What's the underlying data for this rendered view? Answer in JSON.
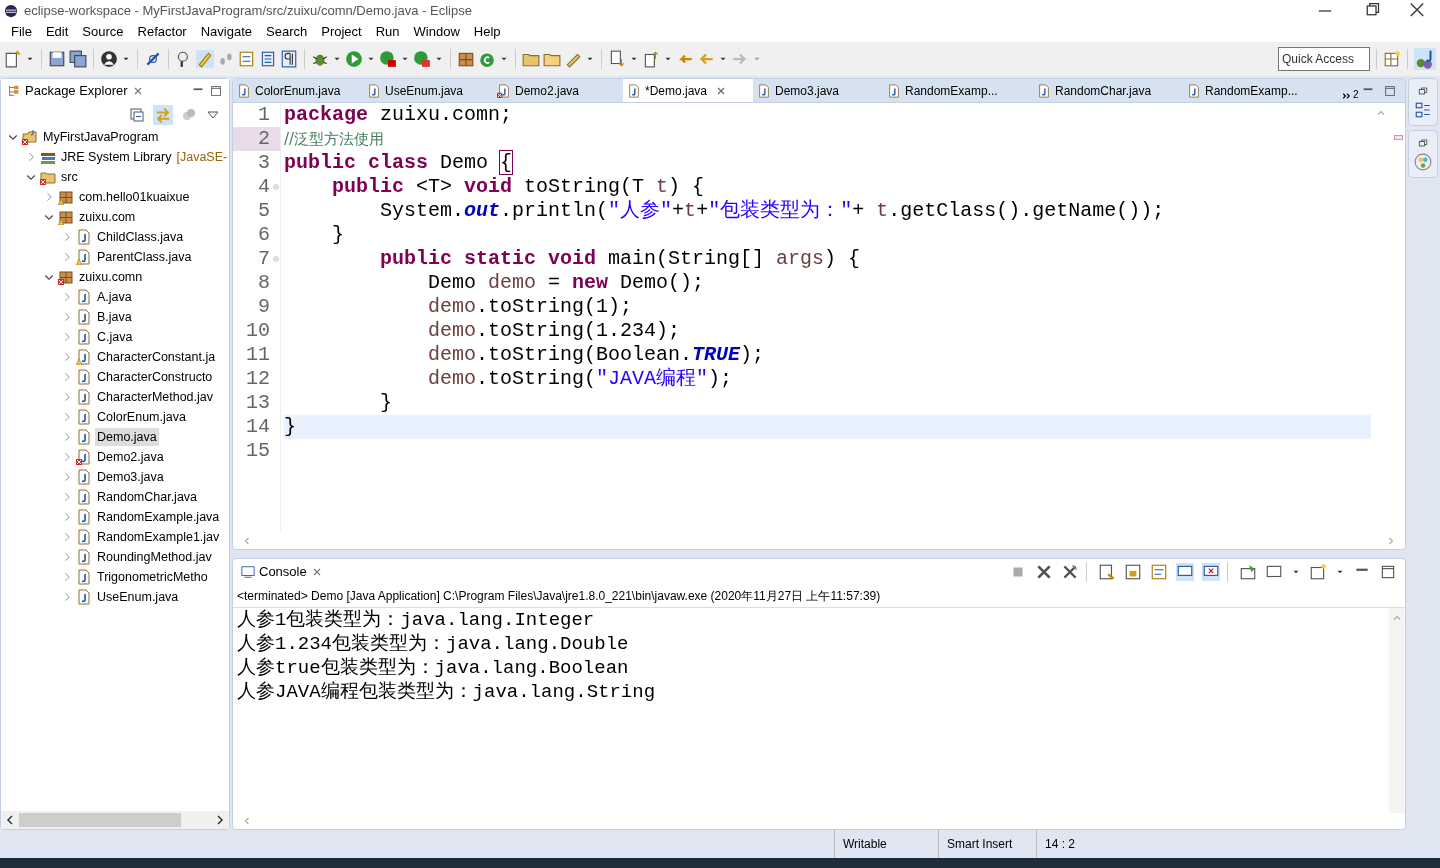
{
  "window": {
    "title": "eclipse-workspace - MyFirstJavaProgram/src/zuixu/comn/Demo.java - Eclipse"
  },
  "menu": [
    "File",
    "Edit",
    "Source",
    "Refactor",
    "Navigate",
    "Search",
    "Project",
    "Run",
    "Window",
    "Help"
  ],
  "quick_access": {
    "placeholder": "Quick Access"
  },
  "package_explorer": {
    "title": "Package Explorer",
    "tree": [
      {
        "label": "MyFirstJavaProgram",
        "kind": "project",
        "error": true,
        "warning": false,
        "expanded": true,
        "selected": false,
        "children": [
          {
            "label": "JRE System Library",
            "suffix": "[JavaSE-",
            "kind": "library",
            "error": false,
            "warning": false,
            "expanded": false,
            "selected": false
          },
          {
            "label": "src",
            "kind": "folder",
            "error": true,
            "warning": false,
            "expanded": true,
            "selected": false,
            "children": [
              {
                "label": "com.hello01kuaixue",
                "kind": "package",
                "error": false,
                "warning": true,
                "expanded": false,
                "selected": false
              },
              {
                "label": "zuixu.com",
                "kind": "package",
                "error": false,
                "warning": true,
                "expanded": true,
                "selected": false,
                "children": [
                  {
                    "label": "ChildClass.java",
                    "kind": "file",
                    "error": false,
                    "warning": false,
                    "expanded": false,
                    "selected": false
                  },
                  {
                    "label": "ParentClass.java",
                    "kind": "file",
                    "error": false,
                    "warning": true,
                    "expanded": false,
                    "selected": false
                  }
                ]
              },
              {
                "label": "zuixu.comn",
                "kind": "package",
                "error": true,
                "warning": false,
                "expanded": true,
                "selected": false,
                "children": [
                  {
                    "label": "A.java",
                    "kind": "file",
                    "error": false,
                    "warning": false,
                    "expanded": false,
                    "selected": false
                  },
                  {
                    "label": "B.java",
                    "kind": "file",
                    "error": false,
                    "warning": false,
                    "expanded": false,
                    "selected": false
                  },
                  {
                    "label": "C.java",
                    "kind": "file",
                    "error": false,
                    "warning": false,
                    "expanded": false,
                    "selected": false
                  },
                  {
                    "label": "CharacterConstant.ja",
                    "kind": "file",
                    "error": false,
                    "warning": true,
                    "expanded": false,
                    "selected": false
                  },
                  {
                    "label": "CharacterConstructo",
                    "kind": "file",
                    "error": false,
                    "warning": false,
                    "expanded": false,
                    "selected": false
                  },
                  {
                    "label": "CharacterMethod.jav",
                    "kind": "file",
                    "error": false,
                    "warning": false,
                    "expanded": false,
                    "selected": false
                  },
                  {
                    "label": "ColorEnum.java",
                    "kind": "file",
                    "error": false,
                    "warning": false,
                    "expanded": false,
                    "selected": false
                  },
                  {
                    "label": "Demo.java",
                    "kind": "file",
                    "error": false,
                    "warning": false,
                    "expanded": false,
                    "selected": true
                  },
                  {
                    "label": "Demo2.java",
                    "kind": "file",
                    "error": true,
                    "warning": false,
                    "expanded": false,
                    "selected": false
                  },
                  {
                    "label": "Demo3.java",
                    "kind": "file",
                    "error": false,
                    "warning": false,
                    "expanded": false,
                    "selected": false
                  },
                  {
                    "label": "RandomChar.java",
                    "kind": "file",
                    "error": false,
                    "warning": false,
                    "expanded": false,
                    "selected": false
                  },
                  {
                    "label": "RandomExample.java",
                    "kind": "file",
                    "error": false,
                    "warning": false,
                    "expanded": false,
                    "selected": false
                  },
                  {
                    "label": "RandomExample1.jav",
                    "kind": "file",
                    "error": false,
                    "warning": false,
                    "expanded": false,
                    "selected": false
                  },
                  {
                    "label": "RoundingMethod.jav",
                    "kind": "file",
                    "error": false,
                    "warning": false,
                    "expanded": false,
                    "selected": false
                  },
                  {
                    "label": "TrigonometricMetho",
                    "kind": "file",
                    "error": false,
                    "warning": false,
                    "expanded": false,
                    "selected": false
                  },
                  {
                    "label": "UseEnum.java",
                    "kind": "file",
                    "error": false,
                    "warning": false,
                    "expanded": false,
                    "selected": false
                  }
                ]
              }
            ]
          }
        ]
      }
    ]
  },
  "editor_tabs": [
    {
      "label": "ColorEnum.java",
      "error": false,
      "selected": false
    },
    {
      "label": "UseEnum.java",
      "error": false,
      "selected": false
    },
    {
      "label": "Demo2.java",
      "error": true,
      "selected": false
    },
    {
      "label": "*Demo.java",
      "error": false,
      "selected": true
    },
    {
      "label": "Demo3.java",
      "error": false,
      "selected": false
    },
    {
      "label": "RandomExamp...",
      "error": false,
      "selected": false
    },
    {
      "label": "RandomChar.java",
      "error": false,
      "selected": false
    },
    {
      "label": "RandomExamp...",
      "error": false,
      "selected": false
    }
  ],
  "hidden_tab_count": "2",
  "code": [
    {
      "no": "1",
      "foldable": false,
      "current": false,
      "marked": false,
      "tokens": [
        {
          "t": "package",
          "kind": "kw"
        },
        {
          "t": " zuixu.comn;",
          "kind": "plain"
        }
      ]
    },
    {
      "no": "2",
      "foldable": false,
      "current": false,
      "marked": true,
      "tokens": [
        {
          "t": "//泛型方法使用",
          "kind": "comment"
        }
      ]
    },
    {
      "no": "3",
      "foldable": false,
      "current": false,
      "marked": false,
      "tokens": [
        {
          "t": "public class",
          "kind": "kw"
        },
        {
          "t": " Demo ",
          "kind": "plain"
        },
        {
          "t": "{",
          "kind": "bracket"
        }
      ]
    },
    {
      "no": "4",
      "foldable": true,
      "current": false,
      "marked": false,
      "tokens": [
        {
          "t": "    public",
          "kind": "kw"
        },
        {
          "t": " <T> ",
          "kind": "plain"
        },
        {
          "t": "void",
          "kind": "kw"
        },
        {
          "t": " toString(T ",
          "kind": "plain"
        },
        {
          "t": "t",
          "kind": "param"
        },
        {
          "t": ") {",
          "kind": "plain"
        }
      ]
    },
    {
      "no": "5",
      "foldable": false,
      "current": false,
      "marked": false,
      "tokens": [
        {
          "t": "        System.",
          "kind": "plain"
        },
        {
          "t": "out",
          "kind": "field"
        },
        {
          "t": ".println(",
          "kind": "plain"
        },
        {
          "t": "\"人参\"",
          "kind": "string"
        },
        {
          "t": "+",
          "kind": "plain"
        },
        {
          "t": "t",
          "kind": "param"
        },
        {
          "t": "+",
          "kind": "plain"
        },
        {
          "t": "\"包装类型为：\"",
          "kind": "string"
        },
        {
          "t": "+ ",
          "kind": "plain"
        },
        {
          "t": "t",
          "kind": "param"
        },
        {
          "t": ".getClass().getName());",
          "kind": "plain"
        }
      ]
    },
    {
      "no": "6",
      "foldable": false,
      "current": false,
      "marked": false,
      "tokens": [
        {
          "t": "    }",
          "kind": "plain"
        }
      ]
    },
    {
      "no": "7",
      "foldable": true,
      "current": false,
      "marked": false,
      "tokens": [
        {
          "t": "        public static void",
          "kind": "kw"
        },
        {
          "t": " main(String[] ",
          "kind": "plain"
        },
        {
          "t": "args",
          "kind": "param"
        },
        {
          "t": ") {",
          "kind": "plain"
        }
      ]
    },
    {
      "no": "8",
      "foldable": false,
      "current": false,
      "marked": false,
      "tokens": [
        {
          "t": "            Demo ",
          "kind": "plain"
        },
        {
          "t": "demo",
          "kind": "local"
        },
        {
          "t": " = ",
          "kind": "plain"
        },
        {
          "t": "new",
          "kind": "kw"
        },
        {
          "t": " Demo();",
          "kind": "plain"
        }
      ]
    },
    {
      "no": "9",
      "foldable": false,
      "current": false,
      "marked": false,
      "tokens": [
        {
          "t": "            demo",
          "kind": "local"
        },
        {
          "t": ".toString(1);",
          "kind": "plain"
        }
      ]
    },
    {
      "no": "10",
      "foldable": false,
      "current": false,
      "marked": false,
      "tokens": [
        {
          "t": "            demo",
          "kind": "local"
        },
        {
          "t": ".toString(1.234);",
          "kind": "plain"
        }
      ]
    },
    {
      "no": "11",
      "foldable": false,
      "current": false,
      "marked": false,
      "tokens": [
        {
          "t": "            demo",
          "kind": "local"
        },
        {
          "t": ".toString(Boolean.",
          "kind": "plain"
        },
        {
          "t": "TRUE",
          "kind": "field"
        },
        {
          "t": ");",
          "kind": "plain"
        }
      ]
    },
    {
      "no": "12",
      "foldable": false,
      "current": false,
      "marked": false,
      "tokens": [
        {
          "t": "            demo",
          "kind": "local"
        },
        {
          "t": ".toString(",
          "kind": "plain"
        },
        {
          "t": "\"JAVA编程\"",
          "kind": "string"
        },
        {
          "t": ");",
          "kind": "plain"
        }
      ]
    },
    {
      "no": "13",
      "foldable": false,
      "current": false,
      "marked": false,
      "tokens": [
        {
          "t": "        }",
          "kind": "plain"
        }
      ]
    },
    {
      "no": "14",
      "foldable": false,
      "current": true,
      "marked": false,
      "tokens": [
        {
          "t": "}",
          "kind": "plain"
        }
      ]
    },
    {
      "no": "15"
    }
  ],
  "console": {
    "title": "Console",
    "status": "<terminated> Demo [Java Application] C:\\Program Files\\Java\\jre1.8.0_221\\bin\\javaw.exe (2020年11月27日 上午11:57:39)",
    "lines": [
      "人参1包装类型为：java.lang.Integer",
      "人参1.234包装类型为：java.lang.Double",
      "人参true包装类型为：java.lang.Boolean",
      "人参JAVA编程包装类型为：java.lang.String"
    ]
  },
  "status_bar": [
    "Writable",
    "Smart Insert",
    "14 : 2"
  ]
}
